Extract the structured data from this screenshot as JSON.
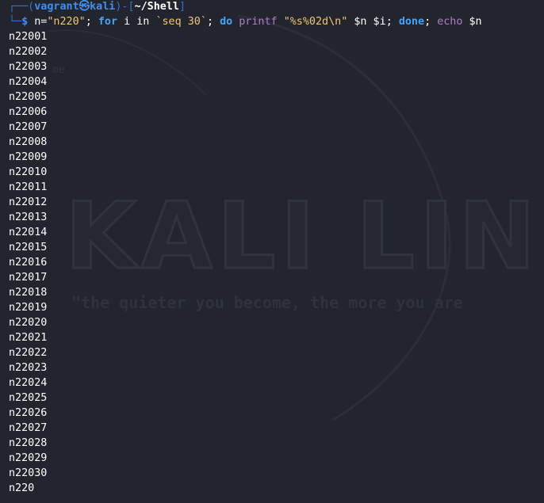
{
  "wallpaper": {
    "logo_text": "KALI LIN",
    "tagline": "\"the quieter you become, the more you are",
    "faint_text": "me"
  },
  "prompt": {
    "open": "┌──(",
    "user": "vagrant",
    "at_symbol": "㉿",
    "host": "kali",
    "mid": ")-[",
    "path": "~/Shell",
    "close": "]",
    "corner": "└─",
    "dollar": "$"
  },
  "command": {
    "var_assign": " n=",
    "str_value": "\"n220\"",
    "sep1": "; ",
    "kw_for": "for",
    "for_rest": " i in ",
    "backtick_cmd": "`seq 30`",
    "sep2": "; ",
    "kw_do": "do",
    "sp1": " ",
    "printf": "printf",
    "sp2": " ",
    "fmt": "\"%s%02d\\n\"",
    "printf_args": " $n $i",
    "sep3": "; ",
    "kw_done": "done",
    "sep4": "; ",
    "echo": "echo",
    "echo_args": " $n"
  },
  "output": [
    "n22001",
    "n22002",
    "n22003",
    "n22004",
    "n22005",
    "n22006",
    "n22007",
    "n22008",
    "n22009",
    "n22010",
    "n22011",
    "n22012",
    "n22013",
    "n22014",
    "n22015",
    "n22016",
    "n22017",
    "n22018",
    "n22019",
    "n22020",
    "n22021",
    "n22022",
    "n22023",
    "n22024",
    "n22025",
    "n22026",
    "n22027",
    "n22028",
    "n22029",
    "n22030",
    "n220"
  ],
  "colors": {
    "background": "#23252e",
    "prompt_blue": "#3f8ef0",
    "string_yellow": "#f0c674",
    "keyword_blue": "#49a3f2",
    "builtin_purple": "#b07cc6"
  }
}
